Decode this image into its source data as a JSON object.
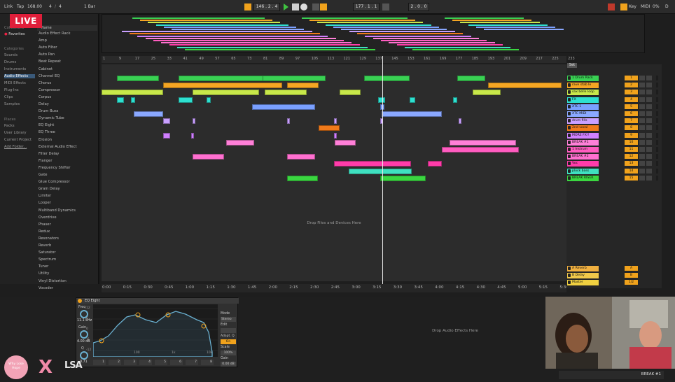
{
  "topbar": {
    "link": "Link",
    "tap": "Tap",
    "tempo": "168.00",
    "sig_num": "4",
    "sig_den": "4",
    "quantize": "1 Bar",
    "bpm_pos": "146 . 2 . 4",
    "loop_pos": "177 . 1 . 1",
    "loop_len": "2 . 0 . 0",
    "key": "Key",
    "midi": "MIDI",
    "pct": "0%",
    "d": "D"
  },
  "live_logo": "LIVE",
  "browser": {
    "collections_label": "Collections",
    "favorites": "Favorites",
    "categories_label": "Categories",
    "categories": [
      "Sounds",
      "Drums",
      "Instruments",
      "Audio Effects",
      "MIDI Effects",
      "Plug-Ins",
      "Clips",
      "Samples"
    ],
    "places_label": "Places",
    "places": [
      "Packs",
      "User Library",
      "Current Project",
      "Add Folder..."
    ],
    "name_col": "Name",
    "items": [
      "Audio Effect Rack",
      "Amp",
      "Auto Filter",
      "Auto Pan",
      "Beat Repeat",
      "Cabinet",
      "Channel EQ",
      "Chorus",
      "Compressor",
      "Corpus",
      "Delay",
      "Drum Buss",
      "Dynamic Tube",
      "EQ Eight",
      "EQ Three",
      "Erosion",
      "External Audio Effect",
      "Filter Delay",
      "Flanger",
      "Frequency Shifter",
      "Gate",
      "Glue Compressor",
      "Grain Delay",
      "Limiter",
      "Looper",
      "Multiband Dynamics",
      "Overdrive",
      "Phaser",
      "Redux",
      "Resonators",
      "Reverb",
      "Saturator",
      "Spectrum",
      "Tuner",
      "Utility",
      "Vinyl Distortion",
      "Vocoder"
    ]
  },
  "ruler_marks": [
    "1",
    "9",
    "17",
    "25",
    "33",
    "41",
    "49",
    "57",
    "65",
    "73",
    "81",
    "89",
    "97",
    "105",
    "113",
    "121",
    "129",
    "137",
    "145",
    "153",
    "161",
    "169",
    "177",
    "185",
    "193",
    "201",
    "209",
    "217",
    "225",
    "233"
  ],
  "timeline_marks": [
    "0:00",
    "0:15",
    "0:30",
    "0:45",
    "1:00",
    "1:15",
    "1:30",
    "1:45",
    "2:00",
    "2:15",
    "2:30",
    "2:45",
    "3:00",
    "3:15",
    "3:30",
    "3:45",
    "4:00",
    "4:15",
    "4:30",
    "4:45",
    "5:00",
    "5:15",
    "5:30"
  ],
  "drop_files": "Drop Files and Devices Here",
  "set_label": "Set",
  "tracks": [
    {
      "name": "1 Drum Rack",
      "num": "1",
      "color": "#39d153"
    },
    {
      "name": "rave stab le",
      "num": "2",
      "color": "#f5a623"
    },
    {
      "name": "sax belle loop",
      "num": "3",
      "color": "#c8e84a"
    },
    {
      "name": "FX",
      "num": "4",
      "color": "#2ee0d0"
    },
    {
      "name": "XTC 1",
      "num": "5",
      "color": "#7aa0ff"
    },
    {
      "name": "XTC MIDI",
      "num": "6",
      "color": "#8aa8ff"
    },
    {
      "name": "drum fills",
      "num": "7",
      "color": "#c9a0ff"
    },
    {
      "name": "2nd vocal",
      "num": "8",
      "color": "#f07a1a"
    },
    {
      "name": "MORE FX!!",
      "num": "9",
      "color": "#d080ff"
    },
    {
      "name": "BREAK #1",
      "num": "10",
      "color": "#ff80d8"
    },
    {
      "name": "1 Instrum",
      "num": "11",
      "color": "#ff5cc0"
    },
    {
      "name": "BREAK #2",
      "num": "12",
      "color": "#ff70d0"
    },
    {
      "name": "Voc",
      "num": "13",
      "color": "#ff3caa"
    },
    {
      "name": "plock bass",
      "num": "14",
      "color": "#3fe0c0"
    },
    {
      "name": "BREAK RISER",
      "num": "15",
      "color": "#3ad640"
    }
  ],
  "returns": [
    {
      "name": "A Reverb",
      "num": "A",
      "color": "#f0b040"
    },
    {
      "name": "B Delay",
      "num": "B",
      "color": "#f0c84a"
    },
    {
      "name": "Master",
      "num": "1/2",
      "color": "#f0d040"
    }
  ],
  "device": {
    "name": "EQ Eight",
    "freq_label": "Freq",
    "freq_val": "11.1 kHz",
    "gain_label": "Gain",
    "gain_val": "4.00 dB",
    "q_label": "Q",
    "q_val": "0.71",
    "mode_label": "Mode",
    "mode_val": "Stereo",
    "edit_label": "Edit",
    "adapt_label": "Adapt. Q",
    "adapt_val": "On",
    "scale_label": "Scale",
    "scale_val": "100%",
    "out_gain_label": "Gain",
    "out_gain_val": "0.00 dB",
    "y_labels": [
      "12",
      "6",
      "0",
      "-6",
      "-12"
    ],
    "x_labels": [
      "100",
      "1k",
      "10k"
    ],
    "bands": [
      "1",
      "2",
      "3",
      "4",
      "5",
      "6",
      "7",
      "8"
    ]
  },
  "drop_audio_fx": "Drop Audio Effects Here",
  "status_track": "BREAK #1",
  "logos": {
    "l1": "Why Lose Hope",
    "l2": "X",
    "l3": "LSA"
  }
}
